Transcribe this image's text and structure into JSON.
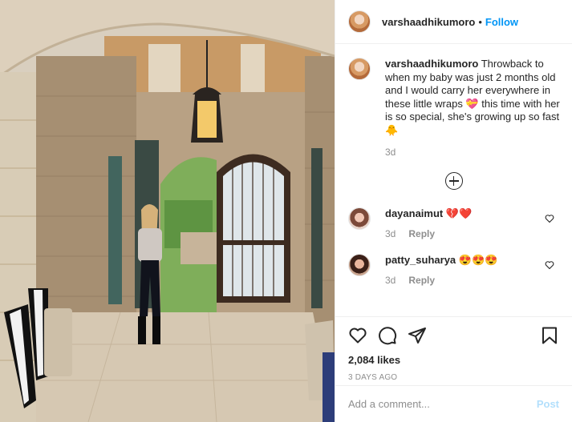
{
  "post": {
    "photo_alt": "",
    "author": "varshaadhikumoro",
    "follow_label": "Follow",
    "separator": "•",
    "caption": "Throwback to when my baby was just 2 months old and I would carry her everywhere in these little wraps 💝 this time with her is so special, she's growing up so fast 🐥",
    "caption_age": "3d"
  },
  "comments": [
    {
      "user": "dayanaimut",
      "text": "💔❤️",
      "age": "3d",
      "reply_label": "Reply"
    },
    {
      "user": "patty_suharya",
      "text": "😍😍😍",
      "age": "3d",
      "reply_label": "Reply"
    }
  ],
  "actions": {
    "likes": "2,084 likes",
    "date": "3 DAYS AGO",
    "icons": [
      "heart-icon",
      "comment-icon",
      "share-icon",
      "bookmark-icon"
    ]
  },
  "add_comment": {
    "placeholder": "Add a comment...",
    "post_label": "Post"
  },
  "colors": {
    "link": "#0095f6",
    "post_disabled": "#b2dffc",
    "muted": "#8e8e8e",
    "border": "#efefef"
  }
}
